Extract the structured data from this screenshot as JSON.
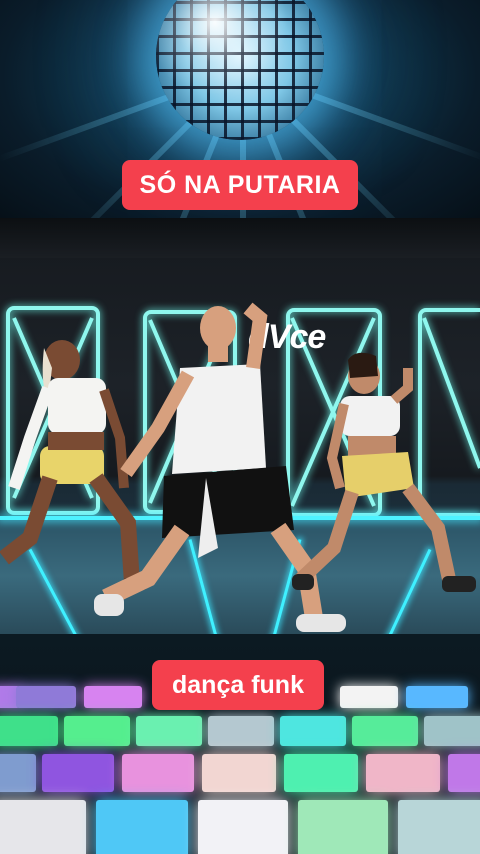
{
  "captions": {
    "top": "SÓ NA PUTARIA",
    "bottom": "dança funk"
  },
  "video": {
    "studio_logo": "dVce"
  },
  "colors": {
    "caption_bg": "#f4404d",
    "caption_text": "#ffffff",
    "neon": "#8ff7ee"
  }
}
